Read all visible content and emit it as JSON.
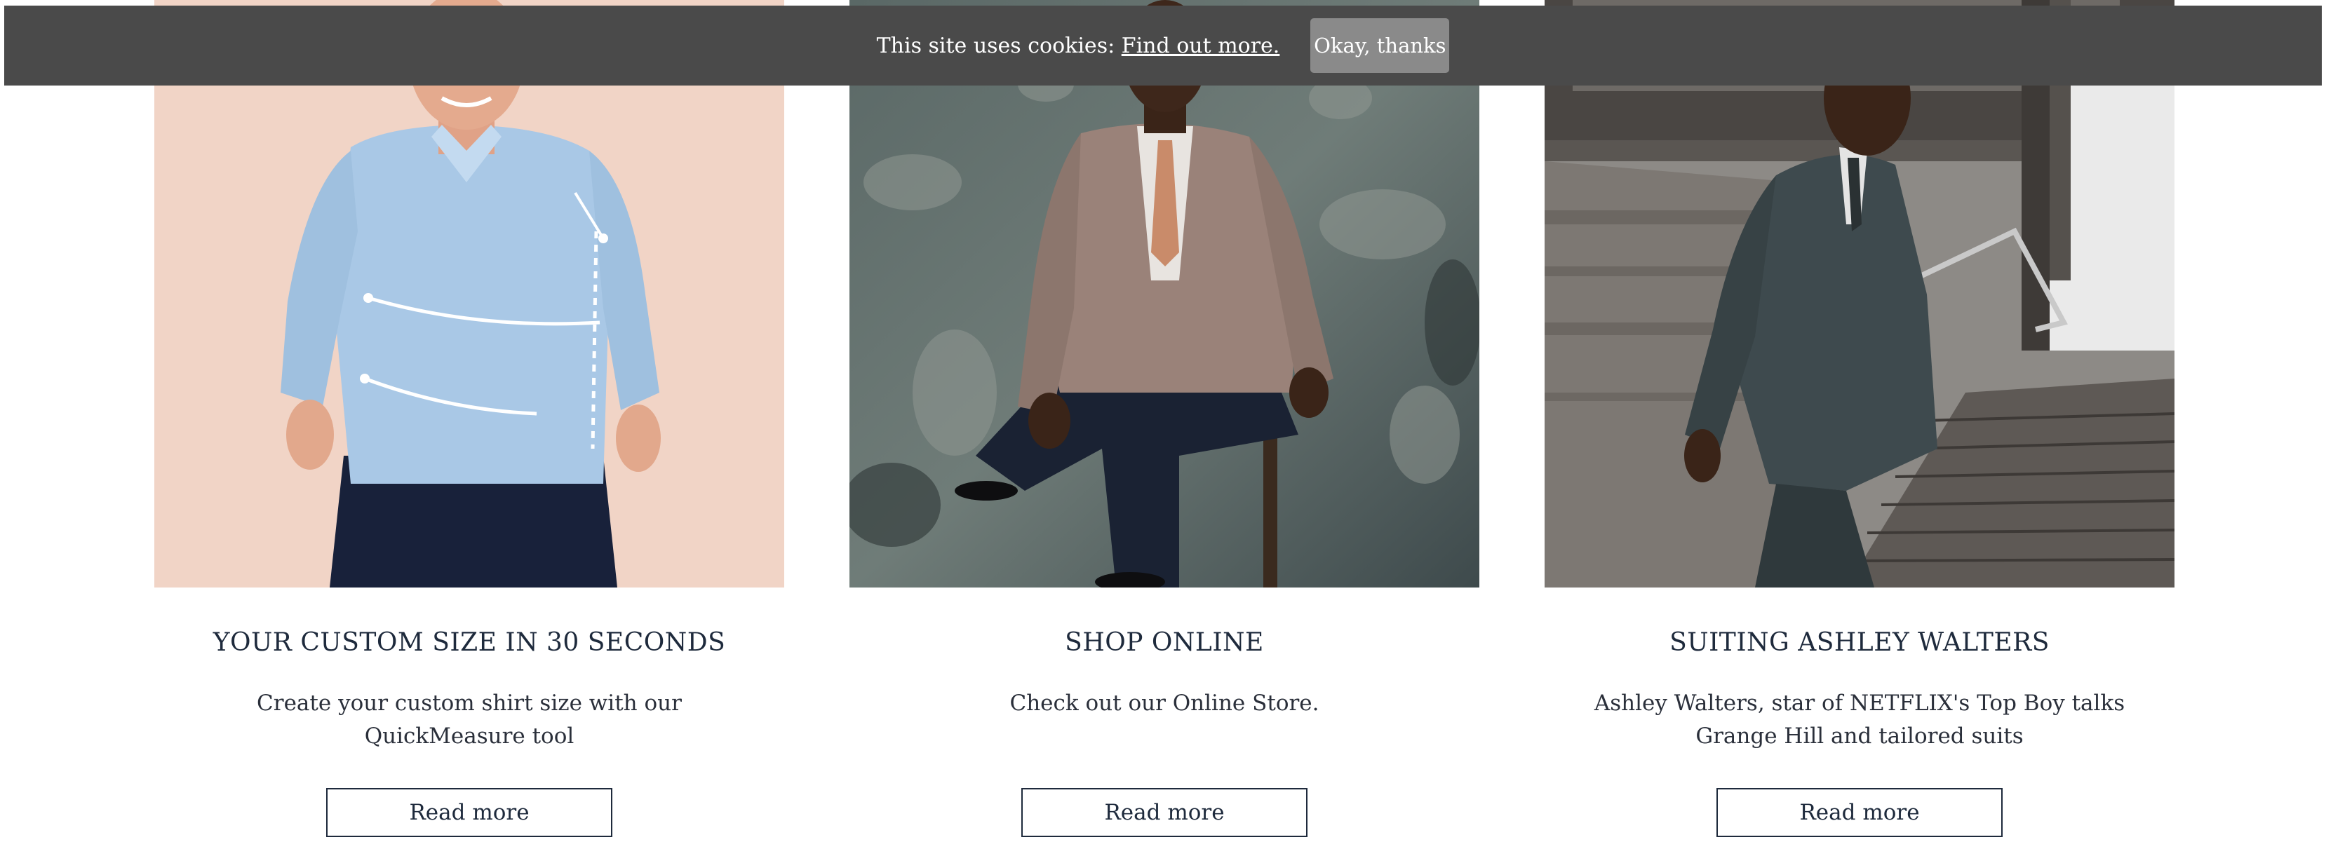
{
  "cookie_banner": {
    "message": "This site uses cookies:",
    "link_label": "Find out more.",
    "accept_label": "Okay, thanks"
  },
  "cards": [
    {
      "title": "YOUR CUSTOM SIZE IN 30 SECONDS",
      "description": "Create your custom shirt size with our QuickMeasure tool",
      "button_label": "Read more"
    },
    {
      "title": "SHOP ONLINE",
      "description": "Check out our Online Store.",
      "button_label": "Read more"
    },
    {
      "title": "SUITING ASHLEY WALTERS",
      "description": "Ashley Walters, star of NETFLIX's Top Boy talks Grange Hill and tailored suits",
      "button_label": "Read more"
    }
  ],
  "colors": {
    "banner_background": "#4a4a4a",
    "accept_button": "#8a8a8a",
    "heading_text": "#1e2a3c"
  }
}
